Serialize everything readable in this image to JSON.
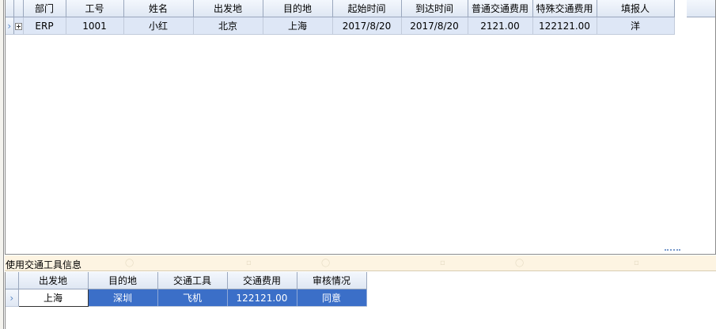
{
  "main_grid": {
    "columns": [
      "部门",
      "工号",
      "姓名",
      "出发地",
      "目的地",
      "起始时间",
      "到达时间",
      "普通交通费用",
      "特殊交通费用",
      "填报人"
    ],
    "rows": [
      {
        "dept": "ERP",
        "emp_id": "1001",
        "name": "小红",
        "from": "北京",
        "to": "上海",
        "start_time": "2017/8/20",
        "arrive_time": "2017/8/20",
        "normal_fee": "2121.00",
        "special_fee": "122121.00",
        "reporter": "洋"
      }
    ],
    "row_indicator": "›"
  },
  "detail_section": {
    "title": "使用交通工具信息"
  },
  "detail_grid": {
    "columns": [
      "出发地",
      "目的地",
      "交通工具",
      "交通费用",
      "审核情况"
    ],
    "rows": [
      {
        "from": "上海",
        "to": "深圳",
        "vehicle": "飞机",
        "fee": "122121.00",
        "status": "同意"
      }
    ],
    "row_indicator": "›"
  },
  "colors": {
    "header_bg": "#dfe7f3",
    "row_bg": "#dee7f6",
    "selection": "#3b6fc8",
    "section_bar": "#fdf4e2"
  },
  "icons": [
    "expand-plus-icon",
    "row-indicator-arrow-icon"
  ]
}
